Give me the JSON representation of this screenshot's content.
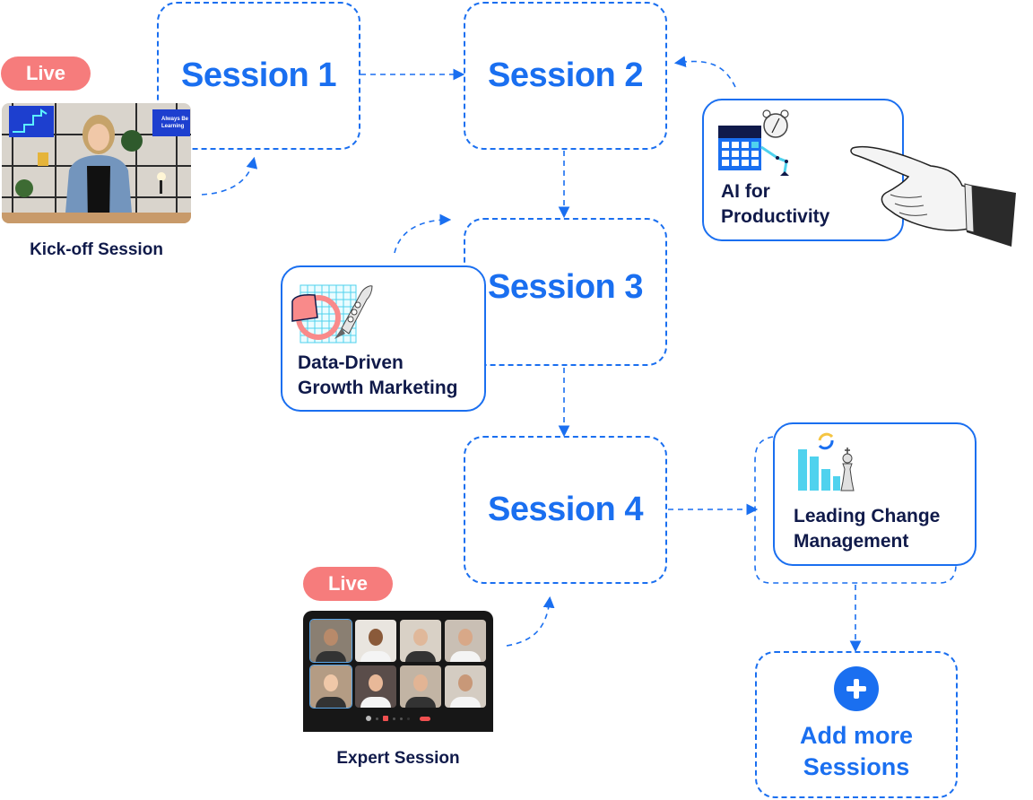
{
  "theme": {
    "accent": "#1a6ff0",
    "text_dark": "#101a4a",
    "live_pill": "#f67c7c",
    "cyan": "#4fd2ee",
    "pink": "#f98a8a",
    "yellow": "#f5c542"
  },
  "sessions": [
    {
      "title": "Session 1"
    },
    {
      "title": "Session 2"
    },
    {
      "title": "Session 3"
    },
    {
      "title": "Session 4"
    }
  ],
  "topics": [
    {
      "label_line1": "AI for",
      "label_line2": "Productivity",
      "icon": "calendar-robot-arm-alarm-clock-icon"
    },
    {
      "label_line1": "Data-Driven",
      "label_line2": "Growth Marketing",
      "icon": "pie-chart-rocket-icon"
    },
    {
      "label_line1": "Leading Change",
      "label_line2": "Management",
      "icon": "bar-chart-chess-king-icon"
    }
  ],
  "kickoff": {
    "badge": "Live",
    "caption": "Kick-off Session",
    "screen_text_line1": "Always Be",
    "screen_text_line2": "Learning"
  },
  "expert": {
    "badge": "Live",
    "caption": "Expert Session",
    "participants": 8
  },
  "add_more": {
    "label_line1": "Add more",
    "label_line2": "Sessions",
    "icon": "plus-circle-icon"
  },
  "decor": {
    "pointing_hand": "pointing-hand-illustration"
  }
}
